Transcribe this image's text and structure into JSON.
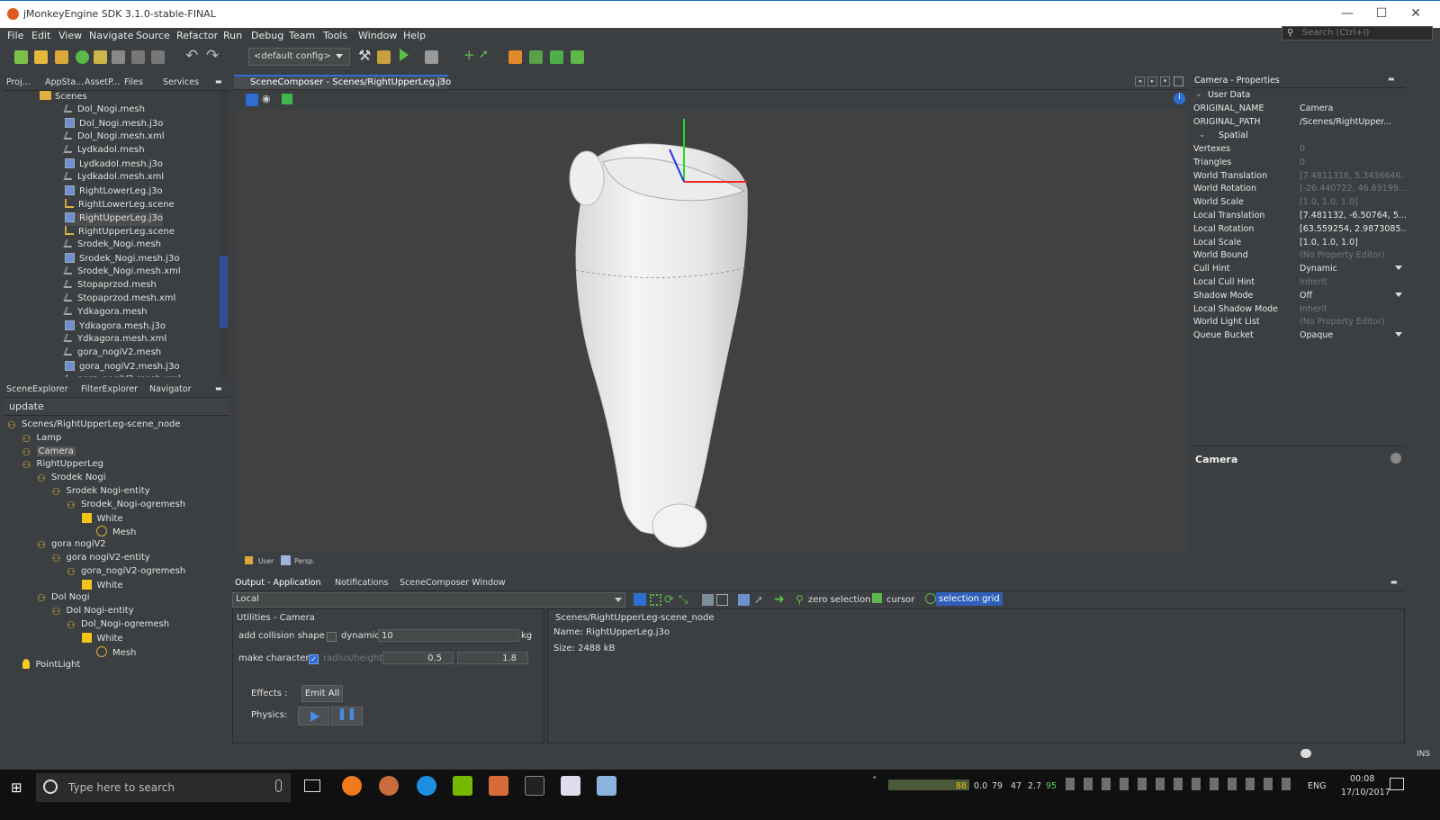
{
  "window": {
    "title": "jMonkeyEngine SDK 3.1.0-stable-FINAL"
  },
  "menu": [
    "File",
    "Edit",
    "View",
    "Navigate",
    "Source",
    "Refactor",
    "Run",
    "Debug",
    "Team",
    "Tools",
    "Window",
    "Help"
  ],
  "search": {
    "placeholder": "Search (Ctrl+I)"
  },
  "toolbar": {
    "config": "<default config>"
  },
  "project_tabs": [
    "Proj...",
    "AppSta...",
    "AssetP...",
    "Files",
    "Services"
  ],
  "files": {
    "folder": "Scenes",
    "items": [
      {
        "name": "Dol_Nogi.mesh",
        "kind": "mesh"
      },
      {
        "name": "Dol_Nogi.mesh.j3o",
        "kind": "j3o"
      },
      {
        "name": "Dol_Nogi.mesh.xml",
        "kind": "mesh"
      },
      {
        "name": "Lydkadol.mesh",
        "kind": "mesh"
      },
      {
        "name": "Lydkadol.mesh.j3o",
        "kind": "j3o"
      },
      {
        "name": "Lydkadol.mesh.xml",
        "kind": "mesh"
      },
      {
        "name": "RightLowerLeg.j3o",
        "kind": "j3o"
      },
      {
        "name": "RightLowerLeg.scene",
        "kind": "scene"
      },
      {
        "name": "RightUpperLeg.j3o",
        "kind": "j3o",
        "selected": true
      },
      {
        "name": "RightUpperLeg.scene",
        "kind": "scene"
      },
      {
        "name": "Srodek_Nogi.mesh",
        "kind": "mesh"
      },
      {
        "name": "Srodek_Nogi.mesh.j3o",
        "kind": "j3o"
      },
      {
        "name": "Srodek_Nogi.mesh.xml",
        "kind": "mesh"
      },
      {
        "name": "Stopaprzod.mesh",
        "kind": "mesh"
      },
      {
        "name": "Stopaprzod.mesh.xml",
        "kind": "mesh"
      },
      {
        "name": "Ydkagora.mesh",
        "kind": "mesh"
      },
      {
        "name": "Ydkagora.mesh.j3o",
        "kind": "j3o"
      },
      {
        "name": "Ydkagora.mesh.xml",
        "kind": "mesh"
      },
      {
        "name": "gora_nogiV2.mesh",
        "kind": "mesh"
      },
      {
        "name": "gora_nogiV2.mesh.j3o",
        "kind": "j3o"
      },
      {
        "name": "gora_nogiV2.mesh.xml",
        "kind": "mesh"
      }
    ]
  },
  "explorer_tabs": [
    "SceneExplorer",
    "FilterExplorer",
    "Navigator"
  ],
  "explorer": {
    "update_label": "update",
    "nodes": [
      {
        "label": "Scenes/RightUpperLeg-scene_node",
        "icon": "node",
        "depth": 0
      },
      {
        "label": "Lamp",
        "icon": "node",
        "depth": 1
      },
      {
        "label": "Camera",
        "icon": "node",
        "depth": 1,
        "selected": true
      },
      {
        "label": "RightUpperLeg",
        "icon": "node",
        "depth": 1
      },
      {
        "label": "Srodek Nogi",
        "icon": "node",
        "depth": 2
      },
      {
        "label": "Srodek Nogi-entity",
        "icon": "node",
        "depth": 3
      },
      {
        "label": "Srodek_Nogi-ogremesh",
        "icon": "node",
        "depth": 4
      },
      {
        "label": "White",
        "icon": "cube",
        "depth": 5
      },
      {
        "label": "Mesh",
        "icon": "grid",
        "depth": 6
      },
      {
        "label": "gora nogiV2",
        "icon": "node",
        "depth": 2
      },
      {
        "label": "gora nogiV2-entity",
        "icon": "node",
        "depth": 3
      },
      {
        "label": "gora_nogiV2-ogremesh",
        "icon": "node",
        "depth": 4
      },
      {
        "label": "White",
        "icon": "cube",
        "depth": 5
      },
      {
        "label": "Dol Nogi",
        "icon": "node",
        "depth": 2
      },
      {
        "label": "Dol Nogi-entity",
        "icon": "node",
        "depth": 3
      },
      {
        "label": "Dol_Nogi-ogremesh",
        "icon": "node",
        "depth": 4
      },
      {
        "label": "White",
        "icon": "cube",
        "depth": 5
      },
      {
        "label": "Mesh",
        "icon": "grid",
        "depth": 6
      },
      {
        "label": "PointLight",
        "icon": "bulb",
        "depth": 1
      }
    ]
  },
  "editor": {
    "tab": "SceneComposer - Scenes/RightUpperLeg.j3o",
    "view_labels": {
      "user": "User",
      "persp": "Persp."
    }
  },
  "properties": {
    "title": "Camera - Properties",
    "section_user": "User Data",
    "section_spatial": "Spatial",
    "rows": [
      {
        "k": "ORIGINAL_NAME",
        "v": "Camera"
      },
      {
        "k": "ORIGINAL_PATH",
        "v": "/Scenes/RightUpper..."
      },
      {
        "k": "Vertexes",
        "v": "0",
        "dim": true
      },
      {
        "k": "Triangles",
        "v": "0",
        "dim": true
      },
      {
        "k": "World Translation",
        "v": "[7.4811316, 5.3436646...",
        "dim": true
      },
      {
        "k": "World Rotation",
        "v": "[-26.440722, 46.69199...",
        "dim": true
      },
      {
        "k": "World Scale",
        "v": "[1.0, 1.0, 1.0]",
        "dim": true
      },
      {
        "k": "Local Translation",
        "v": "[7.481132, -6.50764, 5...."
      },
      {
        "k": "Local Rotation",
        "v": "[63.559254, 2.9873085..."
      },
      {
        "k": "Local Scale",
        "v": "[1.0, 1.0, 1.0]"
      },
      {
        "k": "World Bound",
        "v": "(No Property Editor)",
        "dim": true
      },
      {
        "k": "Cull Hint",
        "v": "Dynamic",
        "dropdown": true
      },
      {
        "k": "Local Cull Hint",
        "v": "Inherit",
        "dim": true
      },
      {
        "k": "Shadow Mode",
        "v": "Off",
        "dropdown": true
      },
      {
        "k": "Local Shadow Mode",
        "v": "Inherit",
        "dim": true
      },
      {
        "k": "World Light List",
        "v": "(No Property Editor)",
        "dim": true
      },
      {
        "k": "Queue Bucket",
        "v": "Opaque",
        "dropdown": true
      }
    ],
    "footer_title": "Camera"
  },
  "output": {
    "tabs": [
      "Output - Application",
      "Notifications",
      "SceneComposer Window"
    ],
    "mode": "Local",
    "tools": {
      "zero_selection": "zero selection",
      "cursor": "cursor",
      "selection_grid": "selection grid"
    },
    "utilities_title": "Utilities - Camera",
    "add_collision_shape": "add collision shape",
    "dynamic_label": "dynamic:",
    "dynamic_value": "10",
    "kg": "kg",
    "make_character": "make character",
    "radius_height": "radius/height",
    "radius_value": "0.5",
    "height_value": "1.8",
    "effects_label": "Effects :",
    "emit_all": "Emit All",
    "physics_label": "Physics:",
    "info_node": "Scenes/RightUpperLeg-scene_node",
    "info_name": "Name: RightUpperLeg.j3o",
    "info_size": "Size: 2488 kB"
  },
  "statusbar": {
    "ins": "INS"
  },
  "taskbar": {
    "search": "Type here to search",
    "tray_numbers": [
      "88",
      "0.0",
      "79",
      "47",
      "2.7",
      "95"
    ],
    "lang": "ENG",
    "time": "00:08",
    "date": "17/10/2017"
  },
  "colors": {
    "accent": "#2e6dd1",
    "panel": "#3c3f41",
    "viewport": "#414141",
    "selection_grid": "#2f5fb8"
  }
}
